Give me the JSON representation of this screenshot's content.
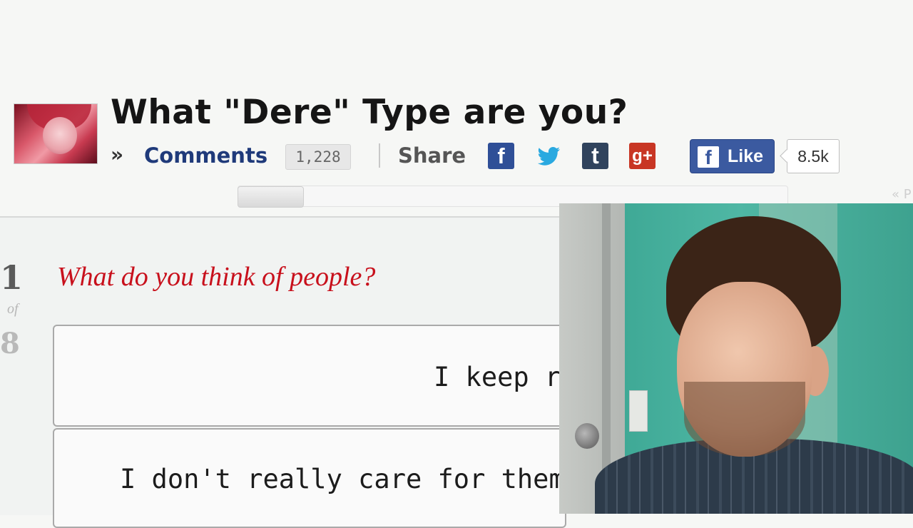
{
  "page": {
    "title": "What \"Dere\" Type are you?",
    "thumbnail_alt": "Quiz thumbnail"
  },
  "meta_bar": {
    "raquo": "»",
    "comments_label": "Comments",
    "comments_count": "1,228",
    "share_label": "Share",
    "share_icons": [
      "facebook-icon",
      "twitter-icon",
      "tumblr-icon",
      "google-plus-icon"
    ],
    "facebook_glyph": "f",
    "tumblr_glyph": "t",
    "google_plus_glyph": "g+",
    "like_label": "Like",
    "like_count": "8.5k"
  },
  "progress": {
    "current_question": 1,
    "total_questions": 8,
    "nav_hint": "« P"
  },
  "quiz": {
    "question_number": "1",
    "of_label": "of",
    "total": "8",
    "question": "What do you think of people?",
    "answers": [
      {
        "text": "I keep r"
      },
      {
        "text": "I don't really care for them",
        "line2": ""
      }
    ]
  },
  "colors": {
    "title": "#151515",
    "comments_link": "#1f3a7a",
    "question": "#c8101c",
    "facebook": "#3b5aa0",
    "tumblr": "#30435d",
    "google_plus": "#c83624",
    "twitter": "#2aa9e0"
  }
}
